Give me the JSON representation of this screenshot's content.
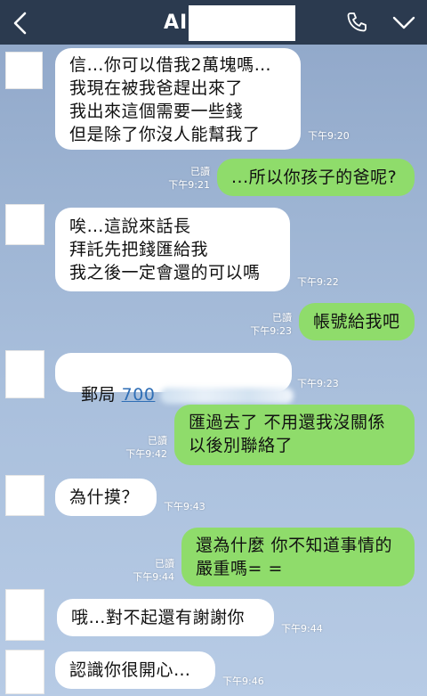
{
  "header": {
    "title": "AIM"
  },
  "messages": [
    {
      "id": "m1",
      "text": "信…你可以借我2萬塊嗎…\n我現在被我爸趕出來了\n我出來這個需要一些錢\n但是除了你沒人能幫我了",
      "time": "下午9:20"
    },
    {
      "id": "m2",
      "text": "...所以你孩子的爸呢?",
      "read": "已讀",
      "time": "下午9:21"
    },
    {
      "id": "m3",
      "text": "唉…這說來話長\n拜託先把錢匯給我\n我之後一定會還的可以嗎",
      "time": "下午9:22"
    },
    {
      "id": "m4",
      "text": "帳號給我吧",
      "read": "已讀",
      "time": "下午9:23"
    },
    {
      "id": "m5",
      "prefix": "郵局 ",
      "account": "700",
      "time": "下午9:23"
    },
    {
      "id": "m6",
      "text": "匯過去了 不用還我沒關係\n以後別聯絡了",
      "read": "已讀",
      "time": "下午9:42"
    },
    {
      "id": "m7",
      "text": "為什摸？",
      "time": "下午9:43"
    },
    {
      "id": "m8",
      "text": "還為什麼 你不知道事情的\n嚴重嗎= =",
      "read": "已讀",
      "time": "下午9:44"
    },
    {
      "id": "m9",
      "text": "哦…對不起還有謝謝你",
      "time": "下午9:44"
    },
    {
      "id": "m10",
      "text": "認識你很開心…",
      "time": "下午9:46"
    }
  ]
}
